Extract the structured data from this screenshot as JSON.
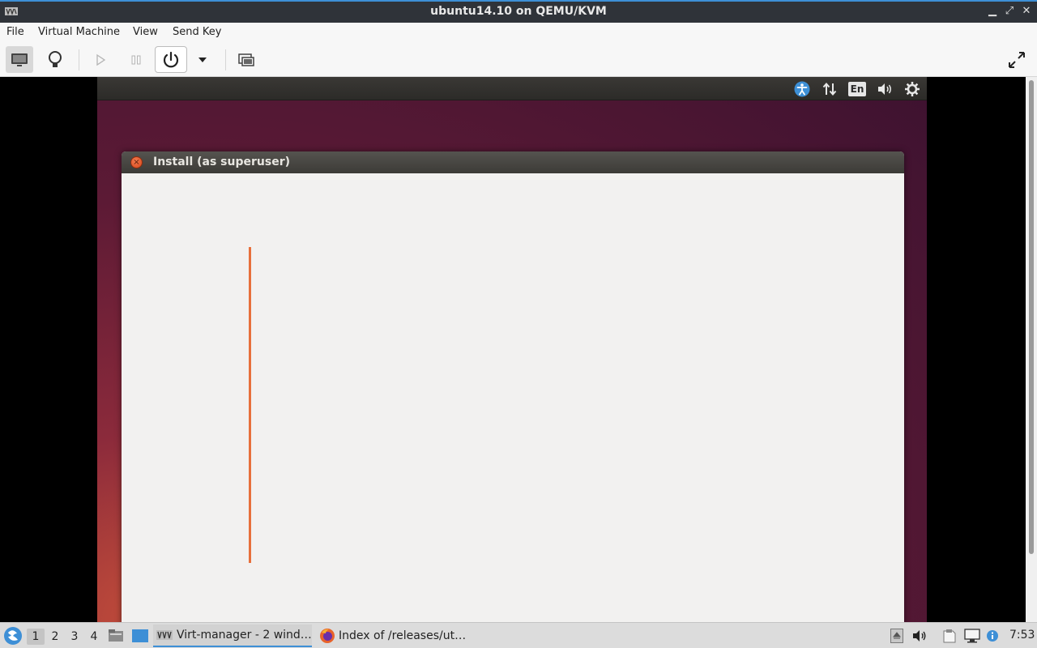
{
  "window": {
    "title": "ubuntu14.10 on QEMU/KVM",
    "minimize_glyph": "▁",
    "maximize_glyph": "⤢",
    "close_glyph": "✕"
  },
  "menu": {
    "file": "File",
    "virtual_machine": "Virtual Machine",
    "view": "View",
    "send_key": "Send Key"
  },
  "toolbar": {
    "icons": [
      "monitor-icon",
      "lightbulb-icon",
      "play-icon",
      "pause-icon",
      "power-icon",
      "chevron-down-icon",
      "snapshot-icon",
      "fullscreen-icon"
    ]
  },
  "guest": {
    "panel": {
      "language": "En"
    },
    "dialog": {
      "title": "Install (as superuser)",
      "close_glyph": "×"
    }
  },
  "taskbar": {
    "workspaces": [
      "1",
      "2",
      "3",
      "4"
    ],
    "tasks": {
      "virt_manager": "Virt-manager - 2 wind…",
      "firefox": "Index of /releases/ut…"
    },
    "clock": "7:53"
  },
  "colors": {
    "accent": "#3d8fd6",
    "installer_progress": "#e76f3b",
    "close_button": "#e0532a"
  }
}
